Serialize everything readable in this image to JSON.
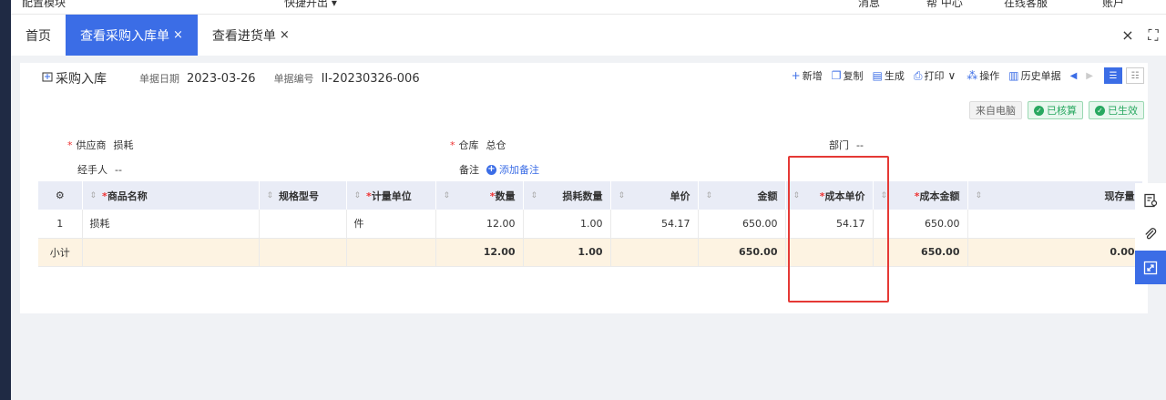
{
  "topbar": {
    "cut_left": "配置模块",
    "cut_mid": "快捷开出 ▾",
    "cut_right1": "消息",
    "cut_right2": "帮 中心",
    "cut_right3": "在线客服",
    "cut_right4": "账户"
  },
  "tabs": [
    {
      "label": "首页",
      "closable": ""
    },
    {
      "label": "查看采购入库单",
      "closable": "×"
    },
    {
      "label": "查看进货单",
      "closable": "×"
    }
  ],
  "tab_actions": {
    "close": "×",
    "fullscreen": "⛶"
  },
  "doc": {
    "tab_label": "采购入库",
    "date_label": "单据日期",
    "date_value": "2023-03-26",
    "no_label": "单据编号",
    "no_value": "II-20230326-006"
  },
  "toolbar": {
    "new": "新增",
    "copy": "复制",
    "generate": "生成",
    "print": "打印",
    "ops": "操作",
    "history": "历史单据"
  },
  "badges": {
    "source": "来自电脑",
    "settled": "已核算",
    "effective": "已生效"
  },
  "fields": {
    "supplier_label": "供应商",
    "supplier_value": "损耗",
    "warehouse_label": "仓库",
    "warehouse_value": "总仓",
    "dept_label": "部门",
    "dept_value": "--",
    "handler_label": "经手人",
    "handler_value": "--",
    "remark_label": "备注",
    "remark_add": "添加备注"
  },
  "table": {
    "headers": {
      "name": "商品名称",
      "spec": "规格型号",
      "unit": "计量单位",
      "qty": "数量",
      "loss_qty": "损耗数量",
      "price": "单价",
      "amount": "金额",
      "cost_price": "成本单价",
      "cost_amount": "成本金额",
      "stock": "现存量"
    },
    "row": {
      "index": "1",
      "name": "损耗",
      "spec": "",
      "unit": "件",
      "qty": "12.00",
      "loss_qty": "1.00",
      "price": "54.17",
      "amount": "650.00",
      "cost_price": "54.17",
      "cost_amount": "650.00",
      "stock": ""
    },
    "sum": {
      "label": "小计",
      "qty": "12.00",
      "loss_qty": "1.00",
      "amount": "650.00",
      "cost_amount": "650.00",
      "stock": "0.00"
    }
  },
  "colors": {
    "accent": "#3b6de6",
    "highlight_box": "#e53935",
    "success": "#28a860"
  }
}
